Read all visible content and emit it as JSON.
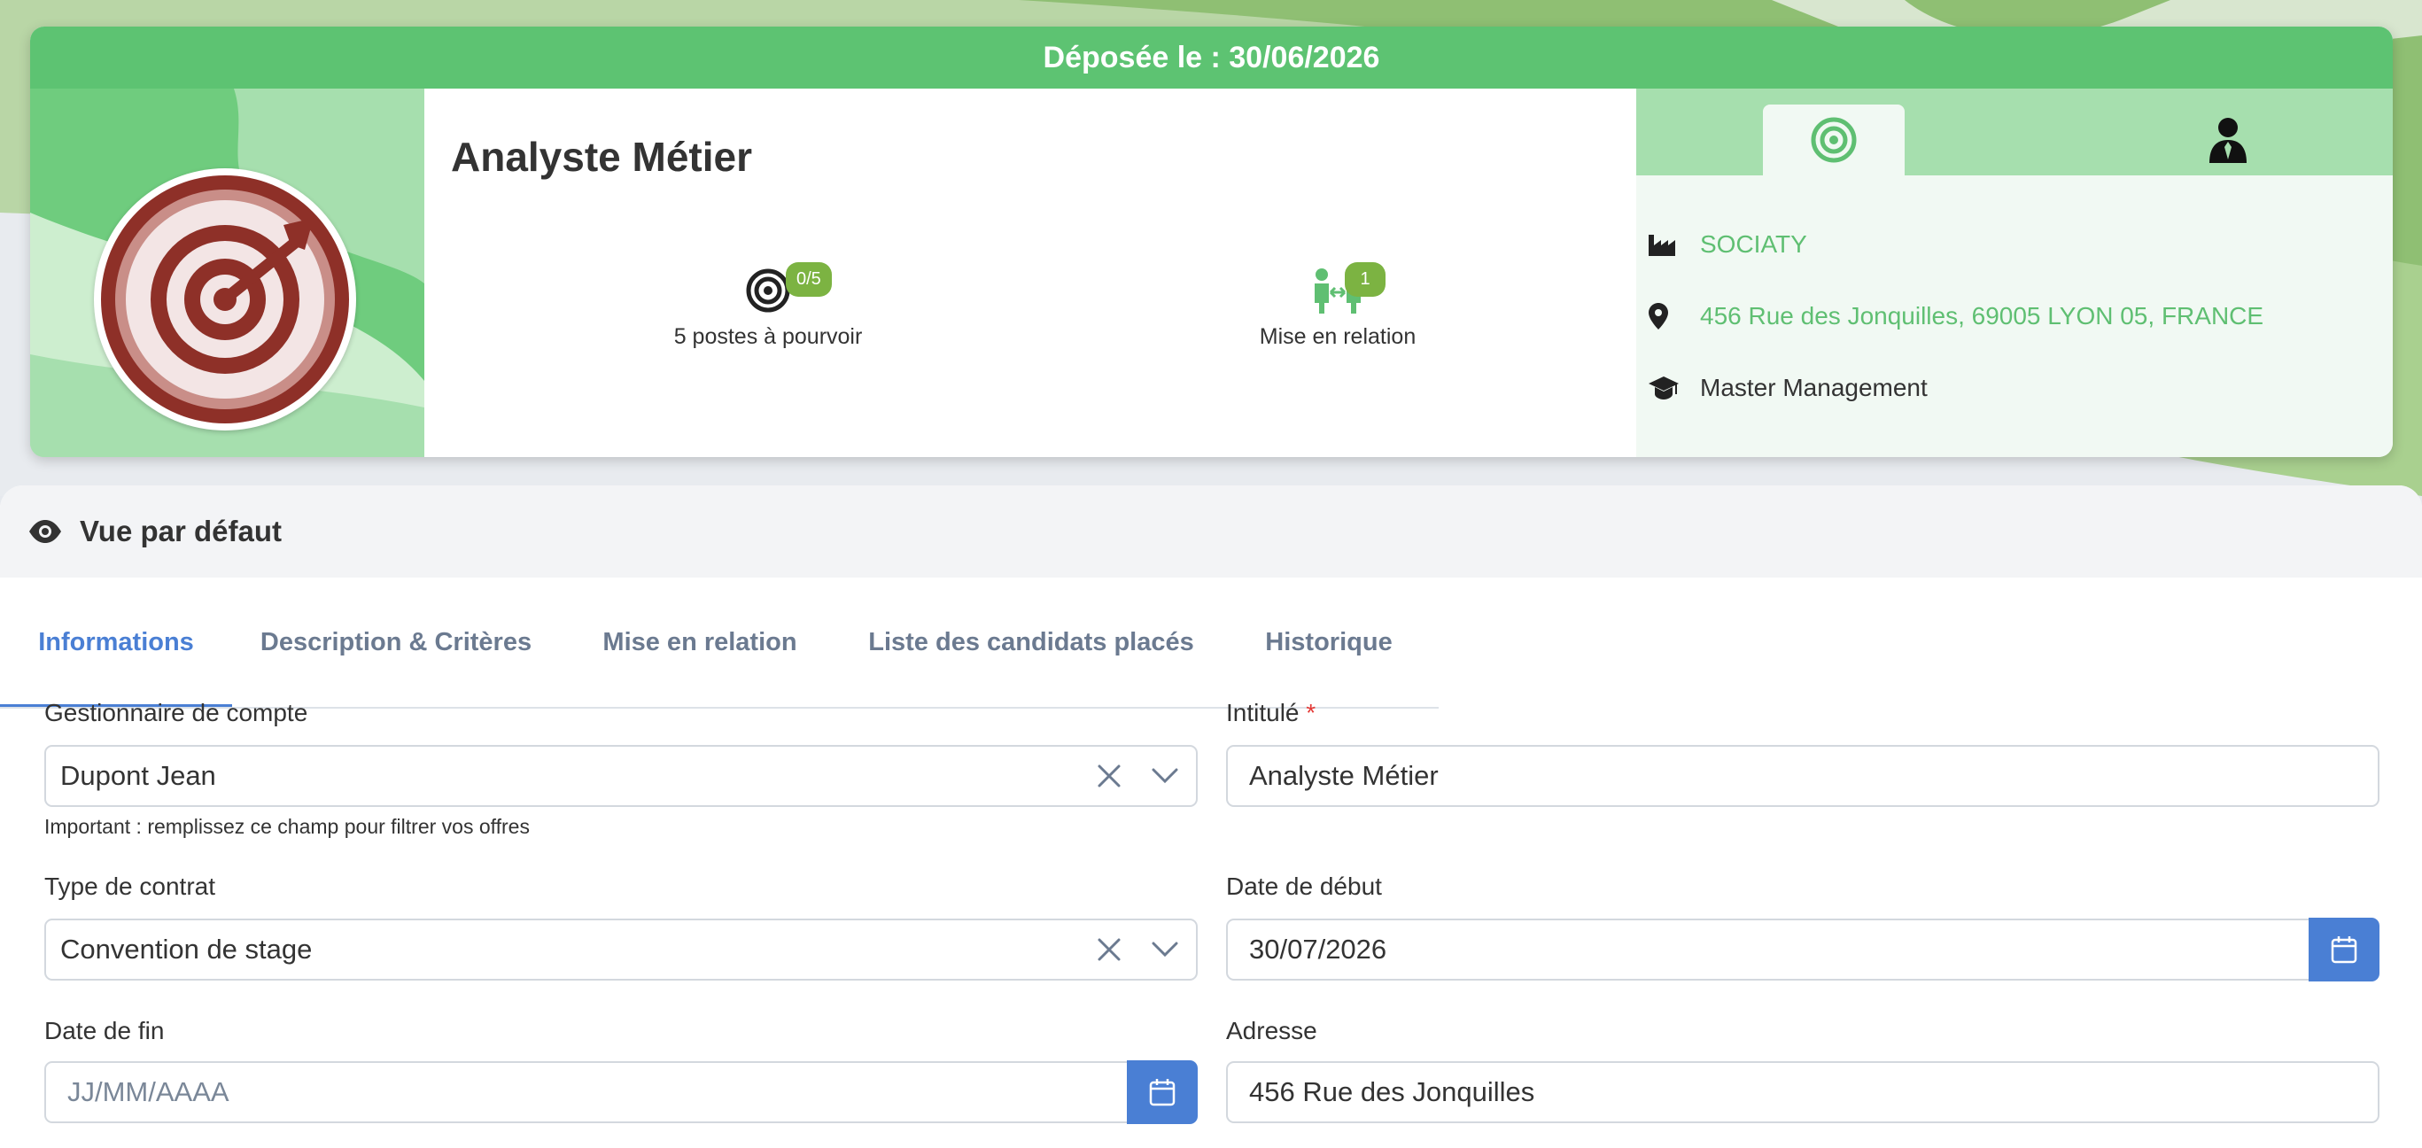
{
  "card": {
    "banner": "Déposée le : 30/06/2026",
    "title": "Analyste Métier",
    "stats": [
      {
        "badge": "0/5",
        "label": "5 postes à pourvoir",
        "icon": "target-icon"
      },
      {
        "badge": "1",
        "label": "Mise en relation",
        "icon": "matching-people-icon"
      }
    ],
    "right_tabs": [
      {
        "icon": "target-icon",
        "active": true
      },
      {
        "icon": "person-tie-icon",
        "active": false
      }
    ],
    "company": "SOCIATY",
    "address": "456 Rue des Jonquilles, 69005 LYON 05, FRANCE",
    "education": "Master Management"
  },
  "view": {
    "icon": "eye-icon",
    "title": "Vue par défaut"
  },
  "tabs": [
    {
      "label": "Informations",
      "active": true
    },
    {
      "label": "Description & Critères",
      "active": false
    },
    {
      "label": "Mise en relation",
      "active": false
    },
    {
      "label": "Liste des candidats placés",
      "active": false
    },
    {
      "label": "Historique",
      "active": false
    }
  ],
  "form": {
    "account_manager": {
      "label": "Gestionnaire de compte",
      "value": "Dupont Jean",
      "help": "Important : remplissez ce champ pour filtrer vos offres"
    },
    "title_field": {
      "label": "Intitulé",
      "required": "*",
      "value": "Analyste Métier"
    },
    "contract_type": {
      "label": "Type de contrat",
      "value": "Convention de stage"
    },
    "start_date": {
      "label": "Date de début",
      "value": "30/07/2026"
    },
    "end_date": {
      "label": "Date de fin",
      "placeholder": "JJ/MM/AAAA"
    },
    "address": {
      "label": "Adresse",
      "value": "456 Rue des Jonquilles"
    }
  },
  "colors": {
    "banner_green": "#5dc372",
    "accent_blue": "#4a7fd4",
    "badge_green": "#7cb342",
    "logo_red": "#8e3028"
  }
}
